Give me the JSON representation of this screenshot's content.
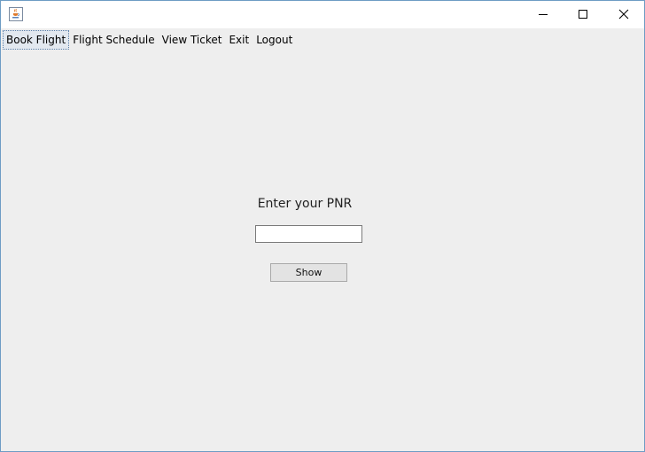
{
  "window": {
    "icon": "java-cup-icon",
    "controls": {
      "minimize": "minimize-icon",
      "maximize": "maximize-icon",
      "close": "close-icon"
    }
  },
  "menubar": {
    "items": [
      {
        "label": "Book Flight",
        "active": true
      },
      {
        "label": "Flight Schedule",
        "active": false
      },
      {
        "label": "View Ticket",
        "active": false
      },
      {
        "label": "Exit",
        "active": false
      },
      {
        "label": "Logout",
        "active": false
      }
    ]
  },
  "form": {
    "pnr_label": "Enter your PNR",
    "pnr_value": "",
    "show_label": "Show"
  },
  "colors": {
    "background": "#eeeeee",
    "titlebar": "#ffffff",
    "border": "#6e9cc4"
  }
}
